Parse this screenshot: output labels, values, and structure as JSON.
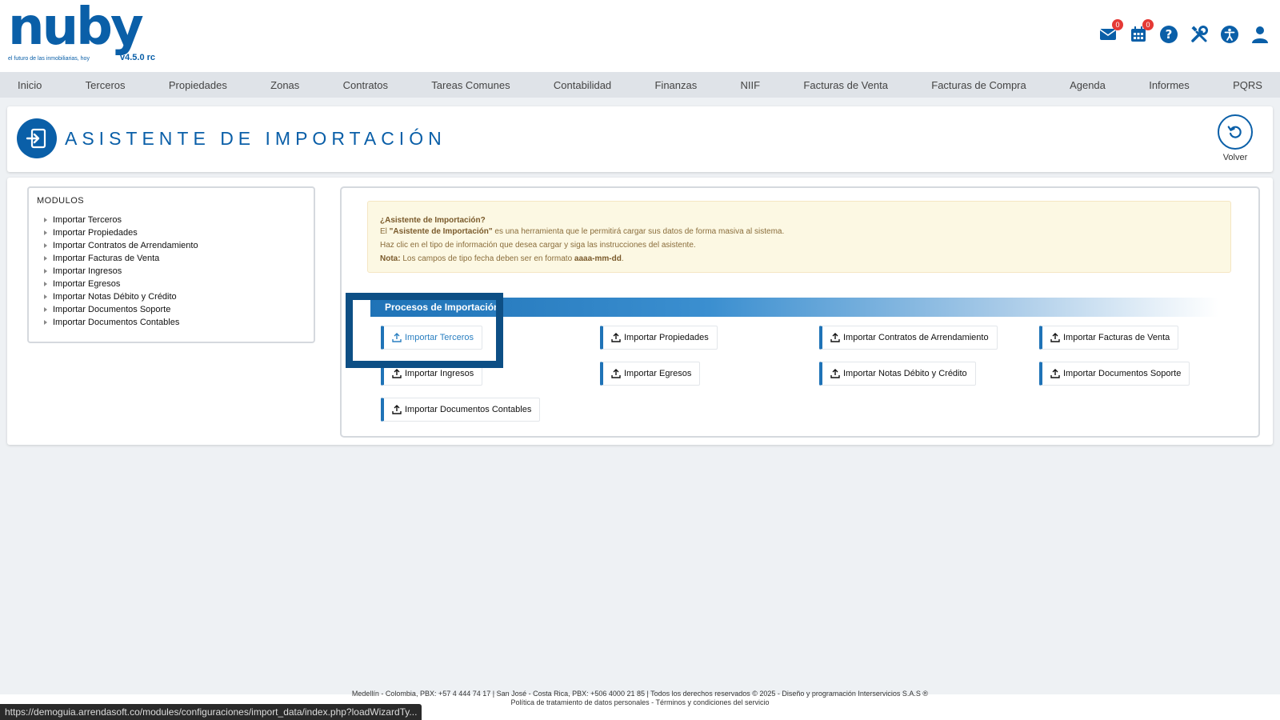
{
  "brand": {
    "logo_text": "nuby",
    "tagline": "el futuro de las inmobiliarias, hoy",
    "version": "v4.5.0 rc"
  },
  "top_icons": {
    "mail_badge": "0",
    "calendar_badge": "0",
    "icons": [
      "mail-icon",
      "calendar-icon",
      "help-icon",
      "tools-icon",
      "accessibility-icon",
      "user-icon"
    ]
  },
  "nav": {
    "items": [
      "Inicio",
      "Terceros",
      "Propiedades",
      "Zonas",
      "Contratos",
      "Tareas Comunes",
      "Contabilidad",
      "Finanzas",
      "NIIF",
      "Facturas de Venta",
      "Facturas de Compra",
      "Agenda",
      "Informes",
      "PQRS"
    ]
  },
  "page": {
    "title": "ASISTENTE DE IMPORTACIÓN",
    "back_label": "Volver"
  },
  "modules": {
    "title": "MODULOS",
    "items": [
      "Importar Terceros",
      "Importar Propiedades",
      "Importar Contratos de Arrendamiento",
      "Importar Facturas de Venta",
      "Importar Ingresos",
      "Importar Egresos",
      "Importar Notas Débito y Crédito",
      "Importar Documentos Soporte",
      "Importar Documentos Contables"
    ]
  },
  "notice": {
    "heading": "¿Asistente de Importación?",
    "line1_prefix": "El ",
    "line1_bold": "\"Asistente de Importación\"",
    "line1_suffix": " es una herramienta que le permitirá cargar sus datos de forma masiva al sistema.",
    "line2": "Haz clic en el tipo de información que desea cargar y siga las instrucciones del asistente.",
    "line3_bold": "Nota:",
    "line3_text": " Los campos de tipo fecha deben ser en formato ",
    "line3_format": "aaaa-mm-dd",
    "line3_end": "."
  },
  "processes": {
    "header": "Procesos de Importación",
    "buttons": [
      "Importar Terceros",
      "Importar Propiedades",
      "Importar Contratos de Arrendamiento",
      "Importar Facturas de Venta",
      "Importar Ingresos",
      "Importar Egresos",
      "Importar Notas Débito y Crédito",
      "Importar Documentos Soporte",
      "Importar Documentos Contables"
    ]
  },
  "footer": {
    "line1": "Medellín - Colombia, PBX: +57 4 444 74 17 | San José - Costa Rica, PBX: +506 4000 21 85 | Todos los derechos reservados © 2025 - Diseño y programación Interservicios S.A.S ®",
    "line2": "Política de tratamiento de datos personales - Términos y condiciones del servicio"
  },
  "status_bar": {
    "url": "https://demoguia.arrendasoft.co/modules/configuraciones/import_data/index.php?loadWizardTy..."
  },
  "colors": {
    "brand_blue": "#0a5fa8",
    "accent_blue": "#1f73b7",
    "badge_red": "#e53935",
    "notice_bg": "#fcf8e3",
    "highlight_box": "#0d4f85"
  }
}
